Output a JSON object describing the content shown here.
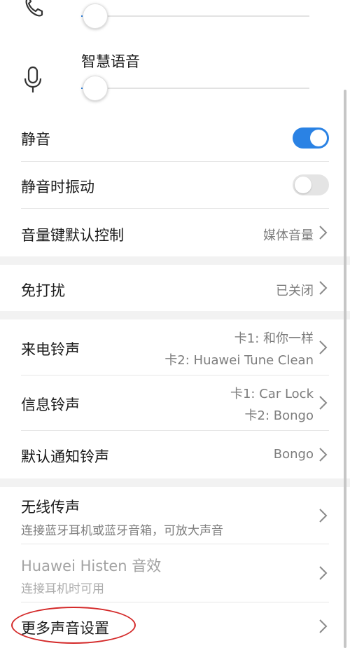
{
  "volume": {
    "call": {
      "icon": "phone-icon",
      "level": 0.06
    },
    "voice_assistant": {
      "label": "智慧语音",
      "icon": "microphone-icon",
      "level": 0.06
    },
    "accent_color": "#2a82e4"
  },
  "settings": {
    "silent": {
      "label": "静音",
      "enabled": true
    },
    "vibrate_when_silent": {
      "label": "静音时振动",
      "enabled": false
    },
    "volume_key_default": {
      "label": "音量键默认控制",
      "value": "媒体音量"
    },
    "do_not_disturb": {
      "label": "免打扰",
      "value": "已关闭"
    },
    "ringtone": {
      "label": "来电铃声",
      "value_line1": "卡1: 和你一样",
      "value_line2": "卡2: Huawei Tune Clean"
    },
    "message_tone": {
      "label": "信息铃声",
      "value_line1": "卡1: Car Lock",
      "value_line2": "卡2: Bongo"
    },
    "notification_tone": {
      "label": "默认通知铃声",
      "value": "Bongo"
    },
    "wireless_audio": {
      "label": "无线传声",
      "subtitle": "连接蓝牙耳机或蓝牙音箱，可放大声音"
    },
    "histen": {
      "label": "Huawei Histen 音效",
      "subtitle": "连接耳机时可用",
      "disabled": true
    },
    "more_sound_settings": {
      "label": "更多声音设置"
    }
  },
  "annotation_color": "#d42a2a"
}
